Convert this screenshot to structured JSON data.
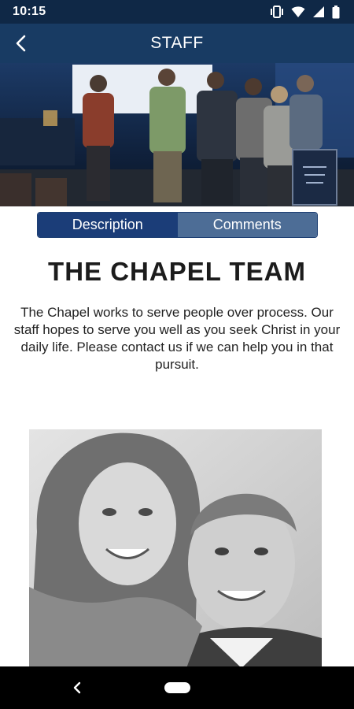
{
  "status_bar": {
    "time": "10:15",
    "icons": [
      "vibrate-icon",
      "wifi-icon",
      "signal-icon",
      "battery-icon"
    ]
  },
  "app_bar": {
    "title": "STAFF",
    "back_icon": "chevron-left-icon"
  },
  "hero": {
    "image": "team-photo"
  },
  "tabs": [
    {
      "label": "Description",
      "active": true
    },
    {
      "label": "Comments",
      "active": false
    }
  ],
  "content": {
    "heading": "THE CHAPEL TEAM",
    "description": "The Chapel works to serve people over process. Our staff hopes to serve you well as you seek Christ in your daily life. Please contact us if we can help you in that pursuit.",
    "photo": "staff-couple-photo"
  },
  "colors": {
    "status_bar": "#0f2846",
    "app_bar": "#183b63",
    "tab_active": "#1b3d78",
    "tab_inactive": "#4d6d96"
  }
}
